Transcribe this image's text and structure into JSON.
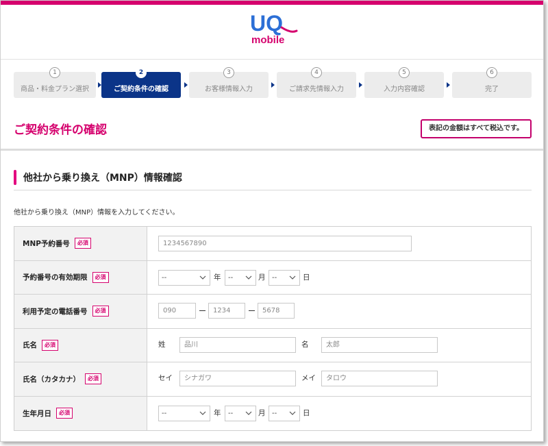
{
  "header": {
    "logo_top": "UQ",
    "logo_bottom": "mobile",
    "brand_color": "#d5006d",
    "logo_blue": "#2c6fd6"
  },
  "steps": [
    {
      "num": "1",
      "label": "商品・料金プラン選択",
      "active": false
    },
    {
      "num": "2",
      "label": "ご契約条件の確認",
      "active": true
    },
    {
      "num": "3",
      "label": "お客様情報入力",
      "active": false
    },
    {
      "num": "4",
      "label": "ご請求先情報入力",
      "active": false
    },
    {
      "num": "5",
      "label": "入力内容確認",
      "active": false
    },
    {
      "num": "6",
      "label": "完了",
      "active": false
    }
  ],
  "page": {
    "title": "ご契約条件の確認",
    "tax_note": "表記の金額はすべて税込です。"
  },
  "section": {
    "title": "他社から乗り換え（MNP）情報確認",
    "intro": "他社から乗り換え（MNP）情報を入力してください。"
  },
  "form": {
    "required_label": "必須",
    "rows": {
      "mnp": {
        "label": "MNP予約番号",
        "placeholder": "1234567890"
      },
      "expiry": {
        "label": "予約番号の有効期限",
        "year_value": "--",
        "month_value": "--",
        "day_value": "--",
        "year_unit": "年",
        "month_unit": "月",
        "day_unit": "日"
      },
      "phone": {
        "label": "利用予定の電話番号",
        "p1": "090",
        "p2": "1234",
        "p3": "5678"
      },
      "name": {
        "label": "氏名",
        "sei_label": "姓",
        "sei_placeholder": "品川",
        "mei_label": "名",
        "mei_placeholder": "太郎"
      },
      "kana": {
        "label": "氏名（カタカナ）",
        "sei_label": "セイ",
        "sei_placeholder": "シナガワ",
        "mei_label": "メイ",
        "mei_placeholder": "タロウ"
      },
      "birth": {
        "label": "生年月日",
        "year_value": "--",
        "month_value": "--",
        "day_value": "--",
        "year_unit": "年",
        "month_unit": "月",
        "day_unit": "日"
      }
    }
  }
}
